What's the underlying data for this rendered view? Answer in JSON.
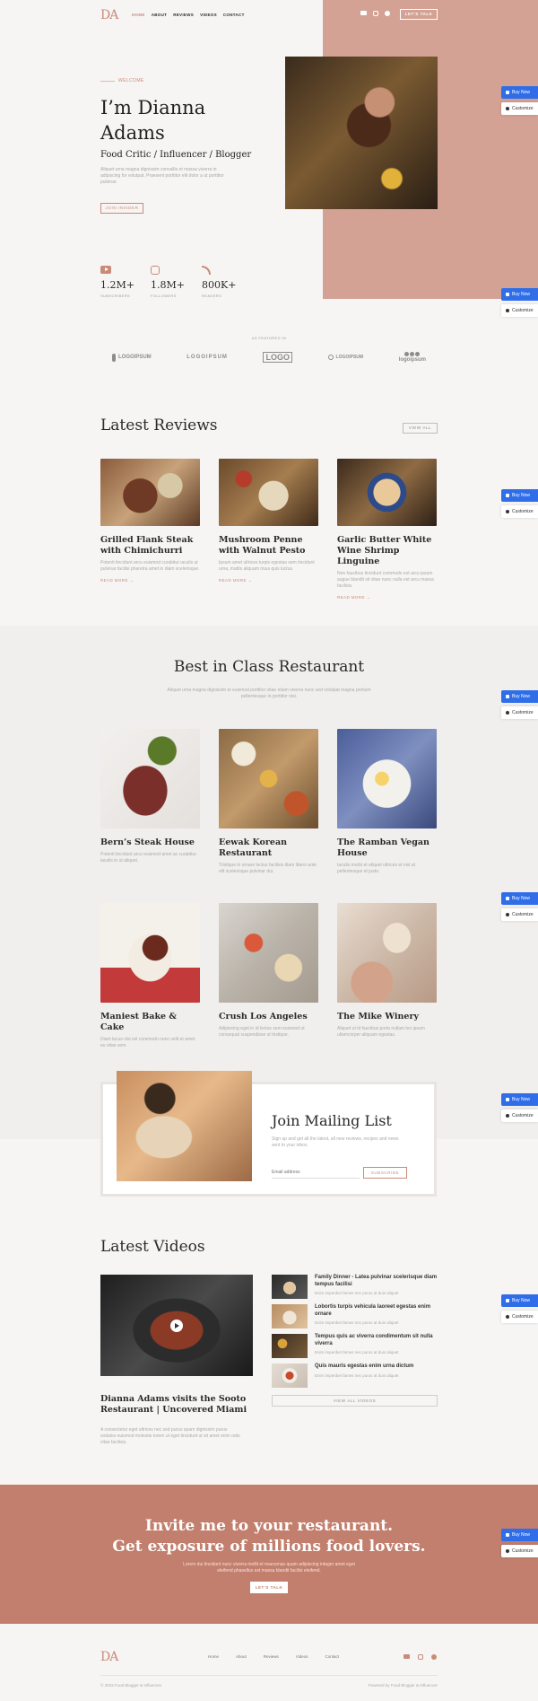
{
  "colors": {
    "accent": "#c98a78",
    "hero_block": "#d4a294",
    "cta_band": "#c27f6d",
    "buy_blue": "#2f6ee8"
  },
  "header": {
    "logo": "DA",
    "nav": [
      "HOME",
      "ABOUT",
      "REVIEWS",
      "VIDEOS",
      "CONTACT"
    ],
    "cta": "LET'S TALK",
    "social_icons": [
      "youtube-icon",
      "instagram-icon",
      "facebook-icon"
    ]
  },
  "hero": {
    "eyebrow": "WELCOME",
    "title": "I’m Dianna Adams",
    "subtitle": "Food Critic / Influencer / Blogger",
    "body": "Aliquet urna magna dignissim convallis et massa viverra in adipiscing for volutpat. Praesent porttitor elit dolor a ut porttitor pulvinar.",
    "button": "JOIN INSIDER"
  },
  "stats": [
    {
      "icon": "youtube-icon",
      "value": "1.2M+",
      "label": "SUBSCRIBERS"
    },
    {
      "icon": "instagram-icon",
      "value": "1.8M+",
      "label": "FOLLOWERS"
    },
    {
      "icon": "rss-icon",
      "value": "800K+",
      "label": "READERS"
    }
  ],
  "featured": {
    "label": "AS FEATURED IN",
    "logos": [
      "LOGOIPSUM",
      "LOGOIPSUM",
      "LOGO",
      "LOGOIPSUM",
      "logoipsum"
    ]
  },
  "reviews": {
    "title": "Latest Reviews",
    "view_all": "VIEW ALL",
    "items": [
      {
        "title": "Grilled Flank Steak with Chimichurri",
        "body": "Potenti tincidunt arcu euismod curabitur iaculis ut pulvinar facilisi pharetra amet in diam scelerisque.",
        "link": "READ MORE →"
      },
      {
        "title": "Mushroom Penne with Walnut Pesto",
        "body": "Ipsum amet ultrices turpis egestas sem tincidunt urna, mattis aliquam risus quis luctus.",
        "link": "READ MORE →"
      },
      {
        "title": "Garlic Butter White Wine Shrimp Linguine",
        "body": "Non faucibus tincidunt commodo est arcu ipsum augue blandit sit vitae nunc nulla est arcu massa facilisis.",
        "link": "READ MORE →"
      }
    ]
  },
  "restaurants": {
    "title": "Best in Class Restaurant",
    "intro": "Aliquet urna magna dignissim et euismod porttitor vitae etiam viverra nunc sed volutpat magna pretium pellentesque in porttitor nisi.",
    "items": [
      {
        "name": "Bern’s Steak House",
        "body": "Potenti tincidunt arcu euismod amet ac curabitur iaculis in ut aliquet."
      },
      {
        "name": "Eewak Korean Restaurant",
        "body": "Tristique in ornare lectus facilisis diam libero ante elit scelerisque pulvinar dui."
      },
      {
        "name": "The Ramban Vegan House",
        "body": "Iaculis morbi et aliquet ultrices et nisl at pellentesque et justo."
      },
      {
        "name": "Maniest Bake & Cake",
        "body": "Diam lacus nisi vel commodo nunc velit et amet eu vitae sem."
      },
      {
        "name": "Crush Los Angeles",
        "body": "Adipiscing eget in id lectus sem euismod ut consequat suspendisse ut tristique."
      },
      {
        "name": "The Mike Winery",
        "body": "Aliquet ut id faucibus porta nullam leo ipsum ullamcorper aliquam egestas."
      }
    ]
  },
  "mailing": {
    "title": "Join Mailing List",
    "body": "Sign up and get all the latest, all new reviews, recipes and news sent to your inbox.",
    "placeholder": "Email address",
    "button": "SUBSCRIBE"
  },
  "videos": {
    "title": "Latest Videos",
    "main_title": "Dianna Adams visits the Sooto Restaurant | Uncovered Miami",
    "main_body": "A consectetur eget ultrices nec sed purus quam dignissim purus sodales euismod molestie lorem ut eget tincidunt ut sit amet enim odio vitae facilisis.",
    "list": [
      {
        "title": "Family Dinner - Latea pulvinar scelerisque diam tempus facilisi",
        "meta": "Enim imperdiet fames nec purus at duis aliquet"
      },
      {
        "title": "Lobortis turpis vehicula laoreet egestas enim ornare",
        "meta": "Enim imperdiet fames nec purus at duis aliquet"
      },
      {
        "title": "Tempus quis ac viverra condimentum sit nulla viverra",
        "meta": "Enim imperdiet fames nec purus at duis aliquet"
      },
      {
        "title": "Quis mauris egestas enim urna dictum",
        "meta": "Enim imperdiet fames nec purus at duis aliquet"
      }
    ],
    "view_all": "VIEW ALL VIDEOS"
  },
  "cta": {
    "line1": "Invite me to your restaurant.",
    "line2": "Get exposure of millions food lovers.",
    "body": "Lorem dui tincidunt nunc viverra mollit et maecenas quam adipiscing integer amet eget eleifend phasellus est massa blandit facilisi eleifend.",
    "button": "LET'S TALK"
  },
  "footer": {
    "logo": "DA",
    "nav": [
      "Home",
      "About",
      "Reviews",
      "Videos",
      "Contact"
    ],
    "copyright": "© 2023 Food Blogger & Influencer",
    "powered": "Powered by Food Blogger & Influencer"
  },
  "side": {
    "buy": "Buy Now",
    "customize": "Customize"
  }
}
